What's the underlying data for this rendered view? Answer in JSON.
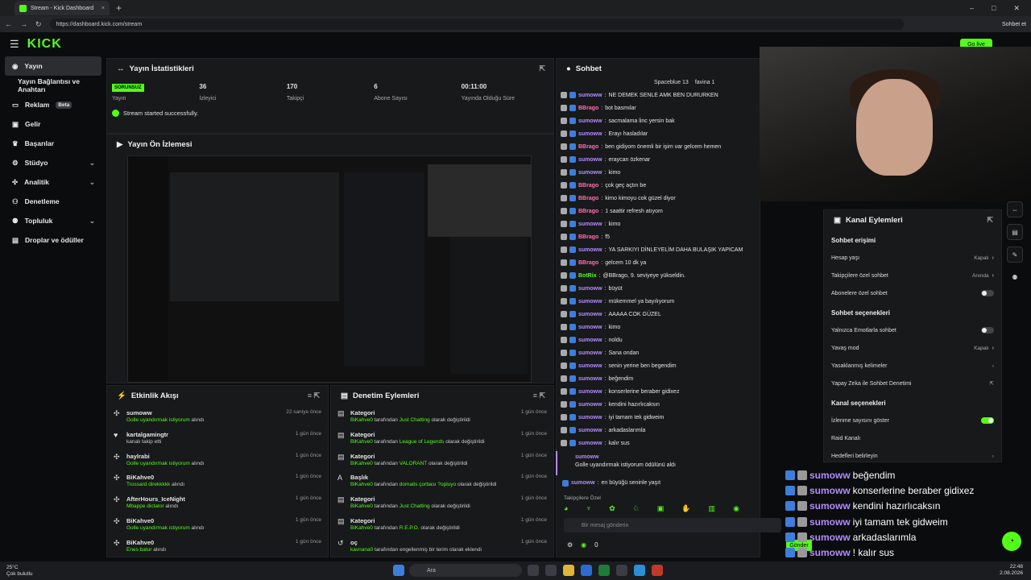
{
  "browser": {
    "tab_title": "Stream - Kick Dashboard",
    "url": "https://dashboard.kick.com/stream",
    "profile_chip": "Sohbet et"
  },
  "header": {
    "logo": "KICK",
    "go_live": "Go live"
  },
  "sidebar": {
    "items": [
      {
        "label": "Yayın",
        "icon": "radio-icon"
      },
      {
        "label": "Yayın Bağlantısı ve Anahtarı",
        "icon": ""
      },
      {
        "label": "Reklam",
        "icon": "monitor-icon",
        "badge": "Beta"
      },
      {
        "label": "Gelir",
        "icon": "dollar-icon"
      },
      {
        "label": "Başarılar",
        "icon": "trophy-icon"
      },
      {
        "label": "Stüdyo",
        "icon": "studio-icon"
      },
      {
        "label": "Analitik",
        "icon": "chart-icon"
      },
      {
        "label": "Denetleme",
        "icon": "shield-icon"
      },
      {
        "label": "Topluluk",
        "icon": "users-icon"
      },
      {
        "label": "Droplar ve ödüller",
        "icon": "gift-icon"
      }
    ]
  },
  "stats": {
    "title": "Yayın İstatistikleri",
    "status_badge": "SORUNSUZ",
    "status_label": "Yayın",
    "items": [
      {
        "value": "36",
        "label": "İzleyici"
      },
      {
        "value": "170",
        "label": "Takipçi"
      },
      {
        "value": "6",
        "label": "Abone Sayısı"
      },
      {
        "value": "00:11:00",
        "label": "Yayında Olduğu Süre"
      }
    ],
    "success": "Stream started successfully."
  },
  "preview": {
    "title": "Yayın Ön İzlemesi"
  },
  "activity": {
    "title": "Etkinlik Akışı",
    "rows": [
      {
        "name": "sumoww",
        "sub": "Golle uyandırmak istiyorum",
        "suffix": " alındı",
        "time": "22 saniye önce"
      },
      {
        "name": "kartalgamingtr",
        "sub": "kanalı takip etti",
        "suffix": "",
        "time": "1 gün önce"
      },
      {
        "name": "haylrabi",
        "sub": "Golle uyandırmak istiyorum",
        "suffix": " alındı",
        "time": "1 gün önce"
      },
      {
        "name": "BiKahve0",
        "sub": "Trossard direkkkkk",
        "suffix": " alındı",
        "time": "1 gün önce"
      },
      {
        "name": "AfterHours_IceNight",
        "sub": "Mbappe dictator",
        "suffix": " alındı",
        "time": "1 gün önce"
      },
      {
        "name": "BiKahve0",
        "sub": "Golle uyandırmak istiyorum",
        "suffix": " alındı",
        "time": "1 gün önce"
      },
      {
        "name": "BiKahve0",
        "sub": "Enes batur",
        "suffix": " alındı",
        "time": "1 gün önce"
      }
    ]
  },
  "moderation": {
    "title": "Denetim Eylemleri",
    "rows": [
      {
        "name": "Kategori",
        "user": "BiKahve0",
        "mid": " tarafından ",
        "val": "Just Chatting",
        "end": " olarak değiştirildi",
        "time": "1 gün önce"
      },
      {
        "name": "Kategori",
        "user": "BiKahve0",
        "mid": " tarafından ",
        "val": "League of Legends",
        "end": " olarak değiştirildi",
        "time": "1 gün önce"
      },
      {
        "name": "Kategori",
        "user": "BiKahve0",
        "mid": " tarafından ",
        "val": "VALORANT",
        "end": " olarak değiştirildi",
        "time": "1 gün önce"
      },
      {
        "name": "Başlık",
        "user": "BiKahve0",
        "mid": " tarafından ",
        "val": "domatis çorbası ?opluyo",
        "end": " olarak değiştirildi",
        "time": "1 gün önce"
      },
      {
        "name": "Kategori",
        "user": "BiKahve0",
        "mid": " tarafından ",
        "val": "Just Chatting",
        "end": " olarak değiştirildi",
        "time": "1 gün önce"
      },
      {
        "name": "Kategori",
        "user": "BiKahve0",
        "mid": " tarafından ",
        "val": "R.E.P.O.",
        "end": " olarak değiştirildi",
        "time": "1 gün önce"
      },
      {
        "name": "oç",
        "user": "kavnana0",
        "mid": " tarafından engellenmiş bir terim olarak eklendi",
        "val": "",
        "end": "",
        "time": "1 gün önce"
      }
    ]
  },
  "chat": {
    "title": "Sohbet",
    "top": [
      "Spaceblue 13",
      "favina 1"
    ],
    "messages": [
      {
        "u": "sumoww",
        "c": "u1",
        "t": "NE DEMEK SENLE AMK BEN DURURKEN"
      },
      {
        "u": "BBrago",
        "c": "u2",
        "t": "bot basmılar"
      },
      {
        "u": "sumoww",
        "c": "u1",
        "t": "sacmalama linc yersin bak"
      },
      {
        "u": "sumoww",
        "c": "u1",
        "t": "Erayı hasladılar"
      },
      {
        "u": "BBrago",
        "c": "u2",
        "t": "ben gidiyom önemli bir işim var gelcem hemen"
      },
      {
        "u": "sumoww",
        "c": "u1",
        "t": "eraycan özkenar"
      },
      {
        "u": "sumoww",
        "c": "u1",
        "t": "kimo"
      },
      {
        "u": "BBrago",
        "c": "u2",
        "t": "çok geç açtın be"
      },
      {
        "u": "BBrago",
        "c": "u2",
        "t": "kimo kimoyu cok güzel diyor"
      },
      {
        "u": "BBrago",
        "c": "u2",
        "t": "1 saattir refresh atıyom"
      },
      {
        "u": "sumoww",
        "c": "u1",
        "t": "kimo"
      },
      {
        "u": "BBrago",
        "c": "u2",
        "t": "f5"
      },
      {
        "u": "sumoww",
        "c": "u1",
        "t": "YA SARKIYI DİNLEYELİM DAHA BULAŞIK YAPICAM"
      },
      {
        "u": "BBrago",
        "c": "u2",
        "t": "gelcem 10 dk ya"
      },
      {
        "u": "BotRix",
        "c": "u3",
        "t": "@BBrago, 9. seviyeye yükseldin."
      },
      {
        "u": "sumoww",
        "c": "u1",
        "t": "büyüt"
      },
      {
        "u": "sumoww",
        "c": "u1",
        "t": "mükemmel ya bayılıyorum"
      },
      {
        "u": "sumoww",
        "c": "u1",
        "t": "AAAAA COK GÜZEL"
      },
      {
        "u": "sumoww",
        "c": "u1",
        "t": "kimo"
      },
      {
        "u": "sumoww",
        "c": "u1",
        "t": "noldu"
      },
      {
        "u": "sumoww",
        "c": "u1",
        "t": "Sana ondan"
      },
      {
        "u": "sumoww",
        "c": "u1",
        "t": "senin yerine ben begendim"
      },
      {
        "u": "sumoww",
        "c": "u1",
        "t": "beğendim"
      },
      {
        "u": "sumoww",
        "c": "u1",
        "t": "konserlerine beraber gidixez"
      },
      {
        "u": "sumoww",
        "c": "u1",
        "t": "kendini hazırlıcaksın"
      },
      {
        "u": "sumoww",
        "c": "u1",
        "t": "iyi tamam tek gidweim"
      },
      {
        "u": "sumoww",
        "c": "u1",
        "t": "arkadaslarımla"
      },
      {
        "u": "sumoww",
        "c": "u1",
        "t": "kalır sus"
      }
    ],
    "redeem_user": "sumoww",
    "redeem_text": "Golle uyandırmak istiyorum ödülünü aldı",
    "last": {
      "u": "sumoww",
      "t": "en büyüğü seninle yaşıt"
    },
    "followers_only": "Takipçilere Özel",
    "placeholder": "Bir mesaj gönderin",
    "send": "Gönder",
    "count": "0"
  },
  "actions": {
    "title": "Kanal Eylemleri",
    "sec1": "Sohbet erişimi",
    "r1": {
      "label": "Hesap yaşı",
      "val": "Kapalı"
    },
    "r2": {
      "label": "Takipçilere özel sohbet",
      "val": "Anında"
    },
    "r3": {
      "label": "Abonelere özel sohbet"
    },
    "sec2": "Sohbet seçenekleri",
    "r4": {
      "label": "Yalnızca Emotlarla sohbet"
    },
    "r5": {
      "label": "Yavaş mod",
      "val": "Kapalı"
    },
    "r6": {
      "label": "Yasaklanmış kelimeler"
    },
    "r7": {
      "label": "Yapay Zeka ile Sohbet Denetimi"
    },
    "sec3": "Kanal seçenekleri",
    "r8": {
      "label": "İzlenme sayısını göster"
    },
    "r9": {
      "label": "Raid Kanalı"
    },
    "r10": {
      "label": "Hedefleri belirleyin"
    }
  },
  "overlay": [
    {
      "u": "sumoww",
      "t": "beğendim"
    },
    {
      "u": "sumoww",
      "t": "konserlerine beraber gidixez"
    },
    {
      "u": "sumoww",
      "t": "kendini hazırlıcaksın"
    },
    {
      "u": "sumoww",
      "t": "iyi tamam tek gidweim"
    },
    {
      "u": "sumoww",
      "t": "arkadaslarımla"
    },
    {
      "u": "sumoww",
      "t": "! kalır sus"
    },
    {
      "u": "sumoww",
      "t": "en büyüğü seninle yaşıt"
    }
  ],
  "taskbar": {
    "temp": "25°C",
    "weather": "Çok bulutlu",
    "search": "Ara",
    "time": "22:48",
    "date": "2.08.2026"
  }
}
